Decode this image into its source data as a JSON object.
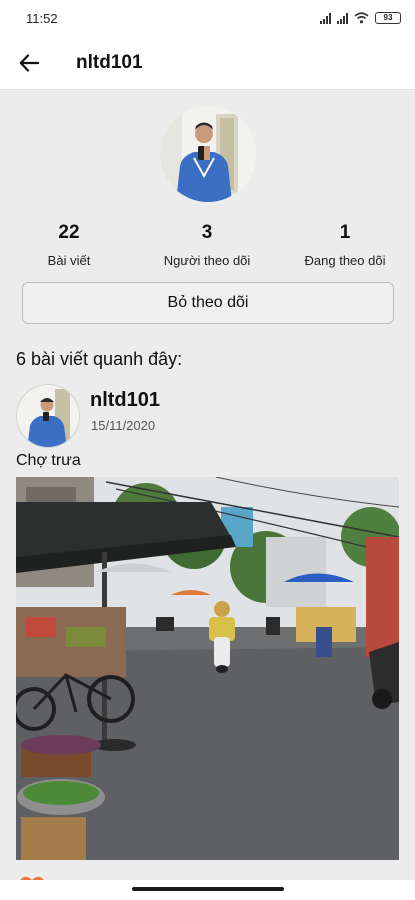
{
  "status_bar": {
    "time": "11:52",
    "battery": "93",
    "icons": [
      "signal-icon",
      "signal-icon",
      "wifi-icon",
      "battery-icon"
    ]
  },
  "app_bar": {
    "back_icon": "arrow-left-icon",
    "title": "nltd101"
  },
  "profile": {
    "stats": [
      {
        "value": "22",
        "label": "Bài viết"
      },
      {
        "value": "3",
        "label": "Người theo dõi"
      },
      {
        "value": "1",
        "label": "Đang theo dõi"
      }
    ],
    "unfollow_label": "Bỏ theo dõi"
  },
  "feed": {
    "section_title": "6 bài viết quanh đây:",
    "posts": [
      {
        "username": "nltd101",
        "date": "15/11/2020",
        "caption": "Chợ trưa"
      }
    ]
  },
  "colors": {
    "background": "#ececec",
    "surface": "#ffffff",
    "accent": "#f07838",
    "button_border": "#bdbdbd"
  }
}
